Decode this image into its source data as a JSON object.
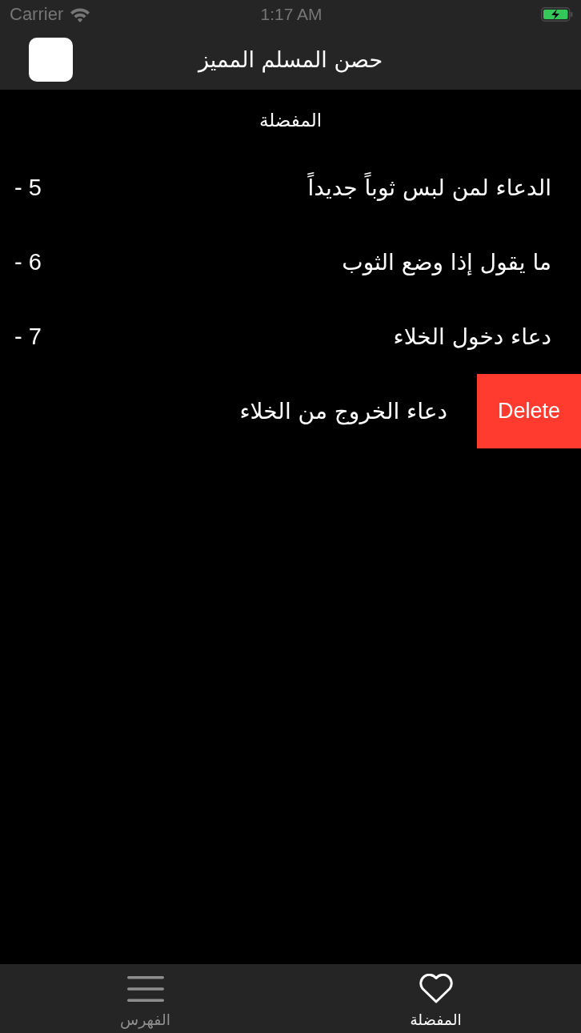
{
  "status_bar": {
    "carrier": "Carrier",
    "time": "1:17 AM",
    "charging": true
  },
  "nav_bar": {
    "title": "حصن المسلم المميز"
  },
  "section_header": "المفضلة",
  "rows": [
    {
      "number": "- 5",
      "title": "الدعاء لمن لبس ثوباً جديداً"
    },
    {
      "number": "- 6",
      "title": "ما يقول إذا وضع الثوب"
    },
    {
      "number": "- 7",
      "title": "دعاء دخول الخلاء"
    },
    {
      "title": "دعاء الخروج من الخلاء",
      "action_label": "Delete"
    }
  ],
  "tabs": [
    {
      "label": "المفضلة",
      "kind": "heart",
      "selected": true
    },
    {
      "label": "الفهرس",
      "kind": "menu",
      "selected": false
    }
  ]
}
